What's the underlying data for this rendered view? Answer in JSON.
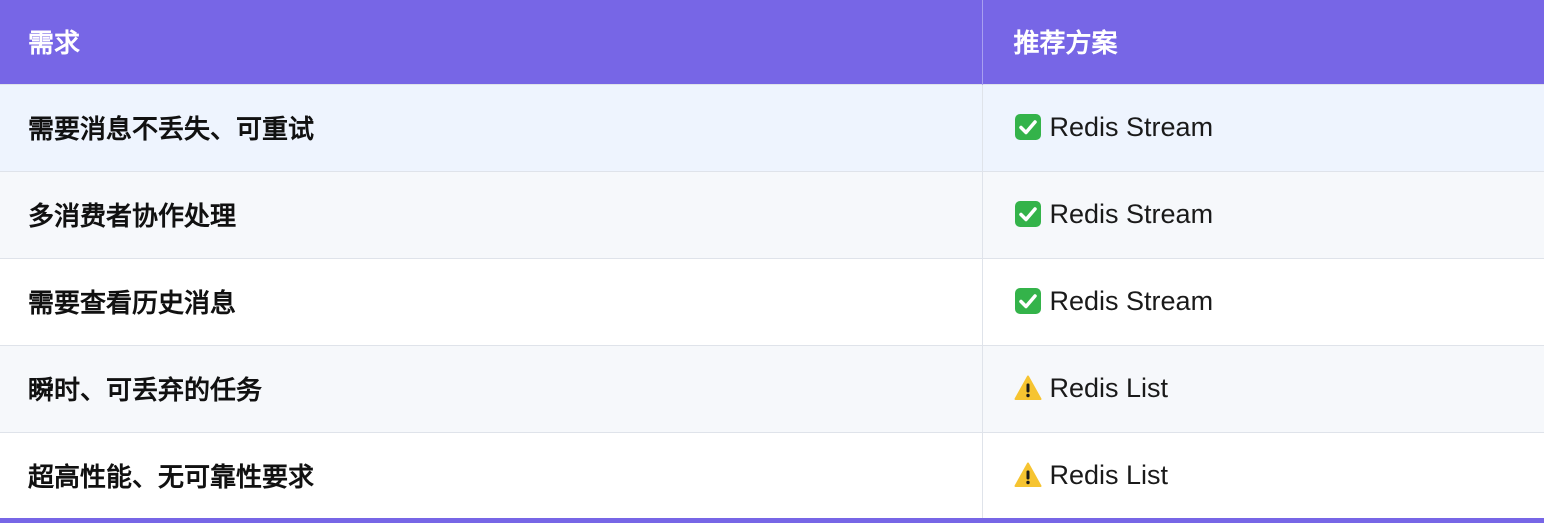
{
  "table": {
    "headers": [
      "需求",
      "推荐方案"
    ],
    "rows": [
      {
        "need": "需要消息不丢失、可重试",
        "icon": "check-icon",
        "solution": "Redis Stream"
      },
      {
        "need": "多消费者协作处理",
        "icon": "check-icon",
        "solution": "Redis Stream"
      },
      {
        "need": "需要查看历史消息",
        "icon": "check-icon",
        "solution": "Redis Stream"
      },
      {
        "need": "瞬时、可丢弃的任务",
        "icon": "warning-icon",
        "solution": "Redis List"
      },
      {
        "need": "超高性能、无可靠性要求",
        "icon": "warning-icon",
        "solution": "Redis List"
      }
    ]
  },
  "colors": {
    "header_bg": "#7766e6",
    "check_green": "#34b34a",
    "warning_yellow": "#f6c431"
  }
}
